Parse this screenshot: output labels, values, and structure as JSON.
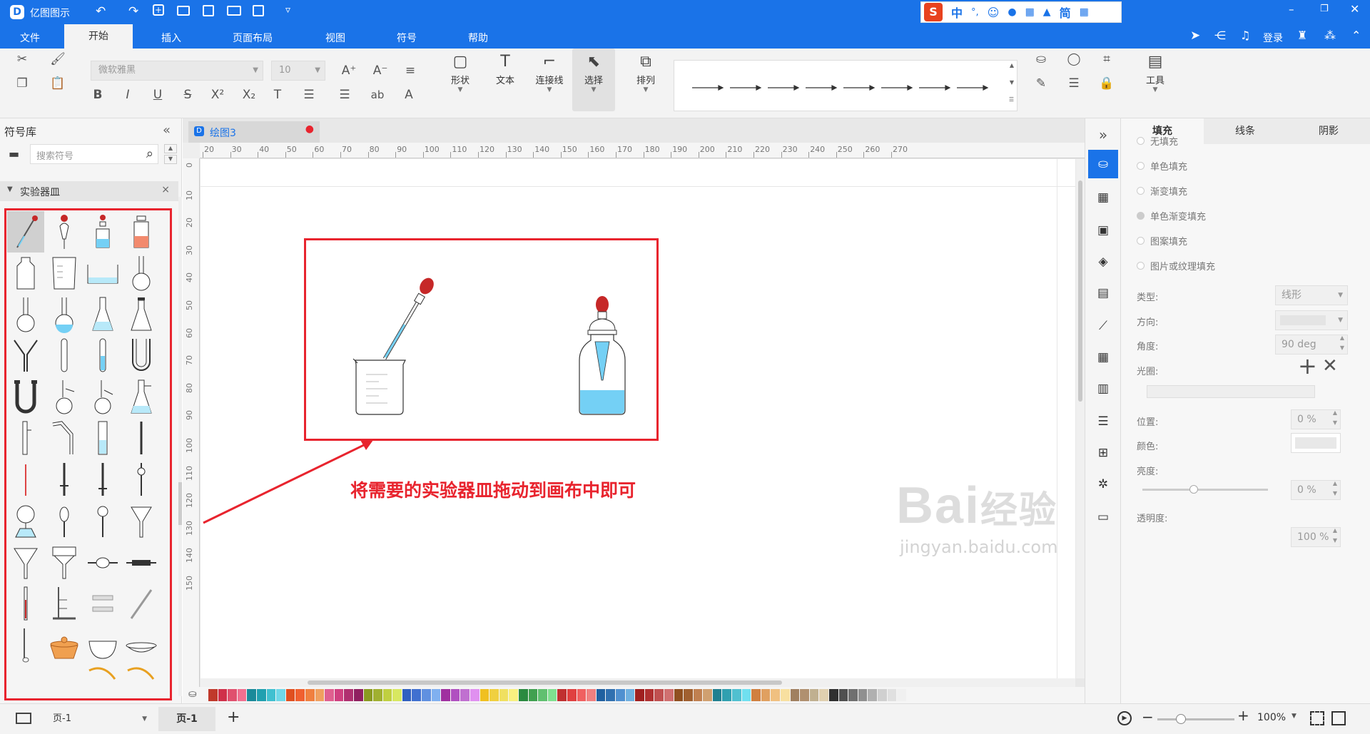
{
  "app": {
    "title": "亿图图示"
  },
  "ime": {
    "items": [
      "中",
      "°,",
      "☺",
      "🎤",
      "⌨",
      "简"
    ]
  },
  "window_controls": [
    "minimize",
    "restore",
    "close"
  ],
  "menu": {
    "items": [
      "文件",
      "开始",
      "插入",
      "页面布局",
      "视图",
      "符号",
      "帮助"
    ],
    "active": "开始",
    "right": {
      "login": "登录"
    }
  },
  "ribbon": {
    "font_name": "微软雅黑",
    "font_size": "10",
    "shape_label": "形状",
    "text_label": "文本",
    "connector_label": "连接线",
    "select_label": "选择",
    "arrange_label": "排列",
    "tools_label": "工具"
  },
  "library": {
    "title": "符号库",
    "search_placeholder": "搜索符号",
    "category": "实验器皿"
  },
  "document": {
    "tab": "绘图3",
    "ruler_h": [
      "20",
      "30",
      "40",
      "50",
      "60",
      "70",
      "80",
      "90",
      "100",
      "110",
      "120",
      "130",
      "140",
      "150",
      "160",
      "170",
      "180",
      "190",
      "200",
      "210",
      "220",
      "230",
      "240",
      "250",
      "260",
      "270"
    ],
    "ruler_v": [
      "0",
      "10",
      "20",
      "30",
      "40",
      "50",
      "60",
      "70",
      "80",
      "90",
      "100",
      "110",
      "120",
      "130",
      "140",
      "150"
    ]
  },
  "annotation": {
    "text": "将需要的实验器皿拖动到画布中即可",
    "color": "#e8242e"
  },
  "right_panel": {
    "tabs": [
      "填充",
      "线条",
      "阴影"
    ],
    "active_tab": "填充",
    "fill_options": [
      "无填充",
      "单色填充",
      "渐变填充",
      "单色渐变填充",
      "图案填充",
      "图片或纹理填充"
    ],
    "selected_fill": "单色渐变填充",
    "type_label": "类型:",
    "type_value": "线形",
    "direction_label": "方向:",
    "angle_label": "角度:",
    "angle_value": "90 deg",
    "aperture_label": "光圈:",
    "position_label": "位置:",
    "position_value": "0 %",
    "color_label": "颜色:",
    "brightness_label": "亮度:",
    "brightness_value": "0 %",
    "transparency_label": "透明度:",
    "transparency_value": "100 %"
  },
  "status": {
    "page_select": "页-1",
    "page_tab": "页-1",
    "zoom": "100%"
  },
  "watermark": {
    "line1": "Bai",
    "line2": "经验",
    "url": "jingyan.baidu.com"
  },
  "colors": {
    "accent": "#1a73e8",
    "highlight": "#e8242e",
    "liquid": "#74d0f5",
    "bulb": "#c62828"
  }
}
